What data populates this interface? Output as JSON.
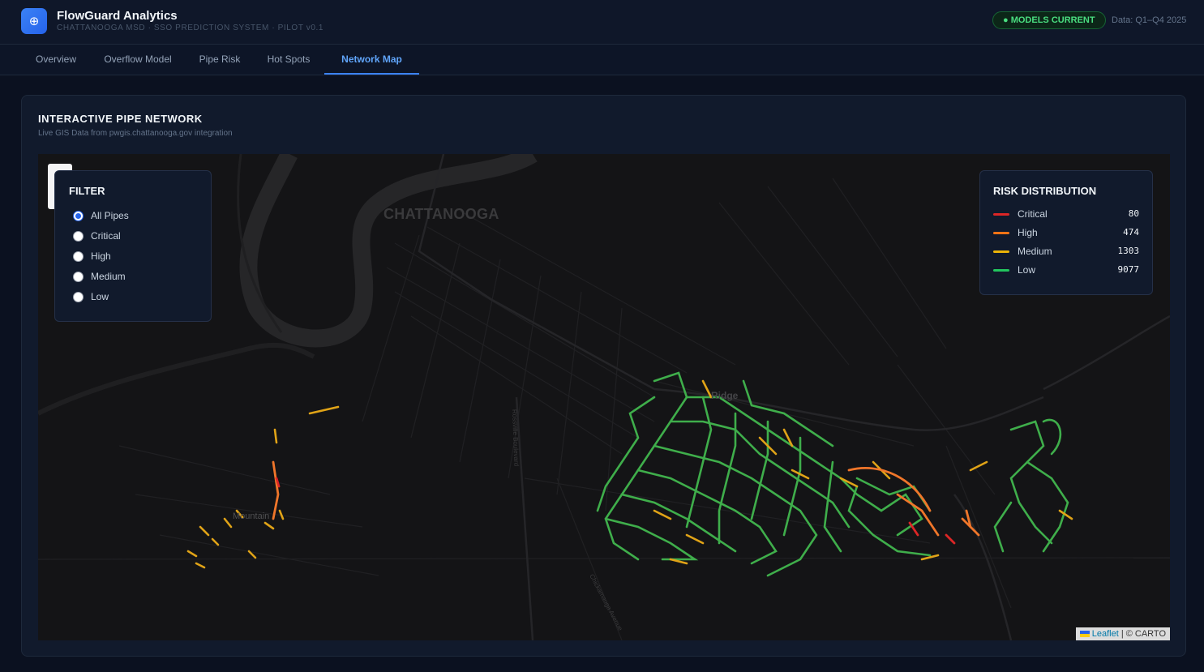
{
  "header": {
    "app_title": "FlowGuard Analytics",
    "app_subtitle": "CHATTANOOGA MSD · SSO PREDICTION SYSTEM · PILOT v0.1",
    "logo_icon": "target-icon",
    "status_badge": "● MODELS CURRENT",
    "data_range": "Data: Q1–Q4 2025"
  },
  "tabs": [
    {
      "label": "Overview"
    },
    {
      "label": "Overflow Model"
    },
    {
      "label": "Pipe Risk"
    },
    {
      "label": "Hot Spots"
    },
    {
      "label": "Network Map",
      "active": true
    }
  ],
  "card": {
    "title": "INTERACTIVE PIPE NETWORK",
    "subtitle": "Live GIS Data from pwgis.chattanooga.gov integration"
  },
  "map": {
    "city_label": "CHATTANOOGA",
    "place_labels": [
      "Ridge",
      "Mountain"
    ],
    "road_labels": [
      "Rossville Boulevard",
      "Chickamauga Avenue"
    ],
    "attribution": {
      "leaflet": "Leaflet",
      "rest": " | © CARTO"
    }
  },
  "filter": {
    "title": "FILTER",
    "selected": "All Pipes",
    "options": [
      "All Pipes",
      "Critical",
      "High",
      "Medium",
      "Low"
    ]
  },
  "risk_distribution": {
    "title": "RISK DISTRIBUTION",
    "items": [
      {
        "label": "Critical",
        "count": "80",
        "color": "#dc2626"
      },
      {
        "label": "High",
        "count": "474",
        "color": "#f97316"
      },
      {
        "label": "Medium",
        "count": "1303",
        "color": "#eab308"
      },
      {
        "label": "Low",
        "count": "9077",
        "color": "#22c55e"
      }
    ]
  }
}
